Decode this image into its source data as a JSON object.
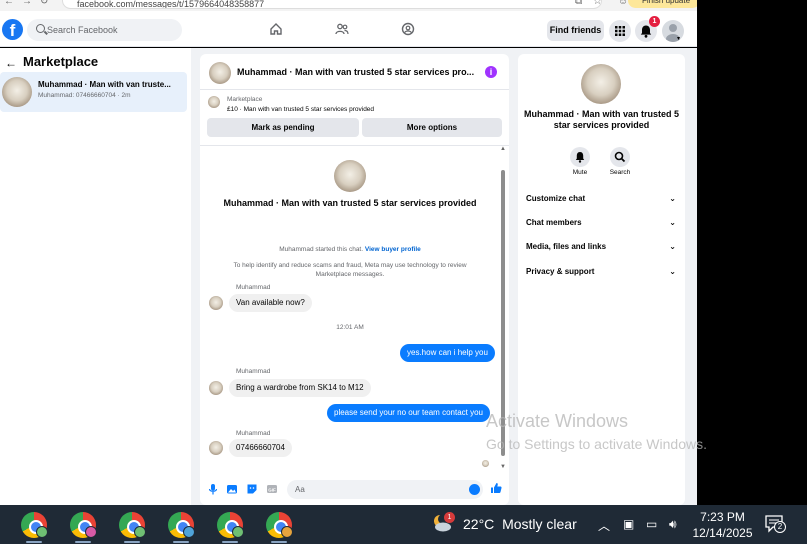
{
  "browser": {
    "url": "facebook.com/messages/t/1579664048358877",
    "finish_update_label": "Finish update"
  },
  "fb": {
    "search_placeholder": "Search Facebook",
    "find_friends_label": "Find friends",
    "notification_count": "1"
  },
  "sidebar": {
    "title": "Marketplace",
    "conversation": {
      "name": "Muhammad · Man with van truste...",
      "snippet": "Muhammad: 07466660704 · 2m"
    }
  },
  "chat": {
    "header_name": "Muhammad · Man with van trusted 5 star services pro...",
    "marketplace_label": "Marketplace",
    "item_label": "£10 · Man with van trusted 5 star services provided",
    "mark_pending_label": "Mark as pending",
    "more_options_label": "More options",
    "big_name": "Muhammad · Man with van trusted 5 star services provided",
    "started_text": "Muhammad started this chat.",
    "view_buyer_profile": "View buyer profile",
    "safety_text": "To help identify and reduce scams and fraud, Meta may use technology to review Marketplace messages.",
    "messages": [
      {
        "sender": "Muhammad",
        "text": "Van available now?"
      },
      {
        "time": "12:01 AM"
      },
      {
        "text": "yes.how can i help you"
      },
      {
        "sender": "Muhammad",
        "text": "Bring a wardrobe from SK14 to M12"
      },
      {
        "text": "please send your no our team contact you"
      },
      {
        "sender": "Muhammad",
        "text": "07466660704"
      }
    ],
    "input_placeholder": "Aa"
  },
  "right_panel": {
    "name": "Muhammad · Man with van trusted 5 star services provided",
    "mute_label": "Mute",
    "search_label": "Search",
    "rows": [
      "Customize chat",
      "Chat members",
      "Media, files and links",
      "Privacy & support"
    ]
  },
  "watermark": {
    "line1": "Activate Windows",
    "line2": "Go to Settings to activate Windows."
  },
  "taskbar": {
    "weather_badge": "1",
    "temperature": "22°C",
    "condition": "Mostly clear",
    "time": "7:23 PM",
    "date": "12/14/2025",
    "notifications": "2"
  },
  "colors": {
    "fb_blue": "#1877f2",
    "bubble_blue": "#0a7cff",
    "badge_red": "#e41e3f",
    "info_purple": "#a033ff"
  }
}
